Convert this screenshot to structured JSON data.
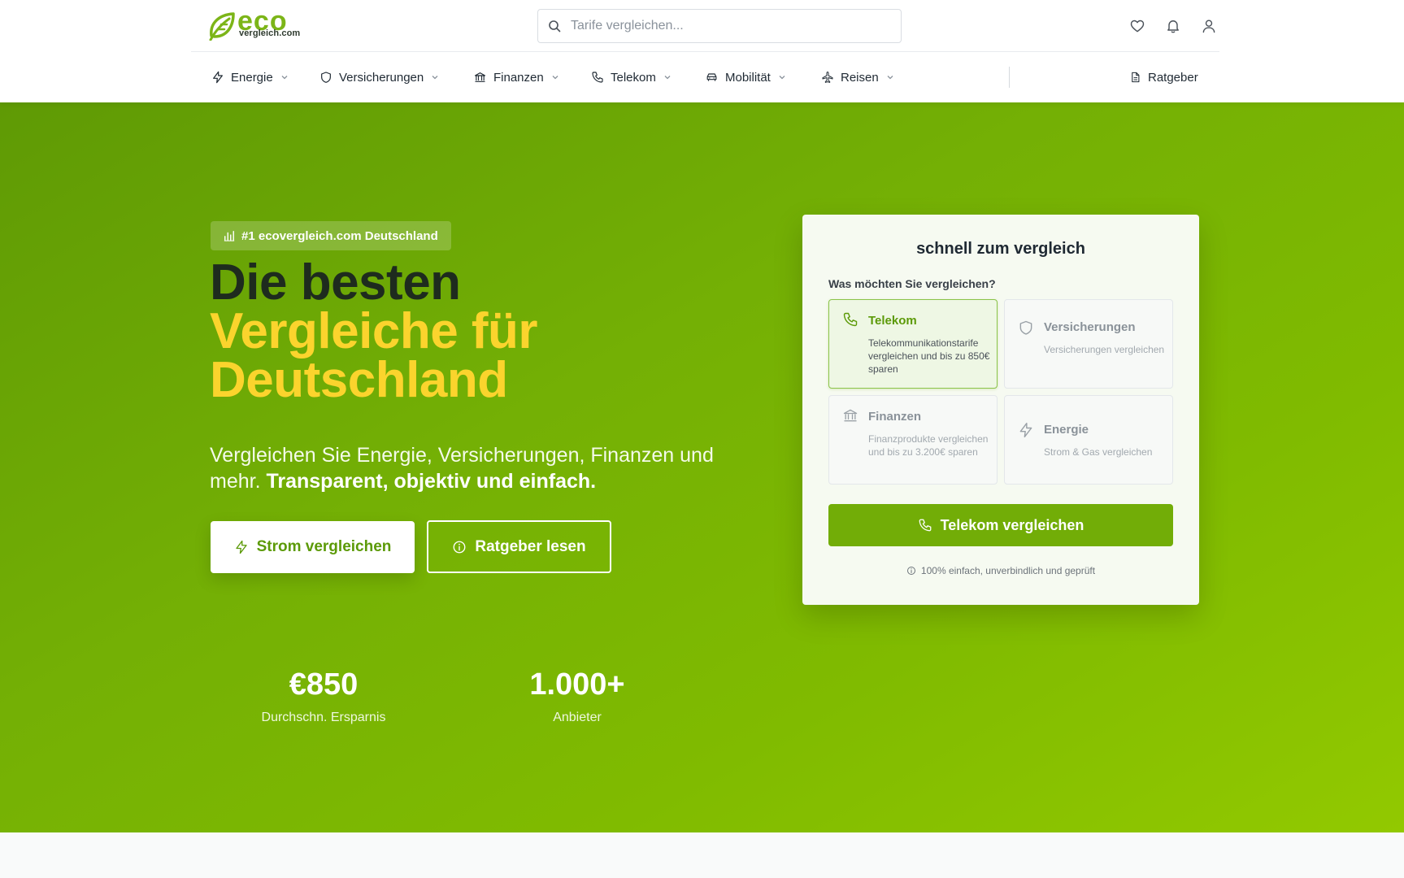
{
  "header": {
    "logo": {
      "brand": "eco",
      "domain": "vergleich.com"
    },
    "search": {
      "placeholder": "Tarife vergleichen..."
    },
    "icons": [
      "heart-icon",
      "bell-icon",
      "user-icon"
    ]
  },
  "nav": {
    "items": [
      {
        "label": "Energie",
        "icon": "bolt-icon"
      },
      {
        "label": "Versicherungen",
        "icon": "shield-icon"
      },
      {
        "label": "Finanzen",
        "icon": "bank-icon"
      },
      {
        "label": "Telekom",
        "icon": "phone-icon"
      },
      {
        "label": "Mobilität",
        "icon": "car-icon"
      },
      {
        "label": "Reisen",
        "icon": "plane-icon"
      }
    ],
    "guide": {
      "label": "Ratgeber",
      "icon": "document-icon"
    }
  },
  "hero": {
    "badge": "#1 ecovergleich.com Deutschland",
    "headline_line1": "Die besten",
    "headline_line2": "Vergleiche für",
    "headline_line3": "Deutschland",
    "subline": "Vergleichen Sie Energie, Versicherungen, Finanzen und mehr.",
    "subline_bold": "Transparent, objektiv und einfach.",
    "primary_button": "Strom vergleichen",
    "secondary_button": "Ratgeber lesen",
    "stats": [
      {
        "value": "€850",
        "label": "Durchschn. Ersparnis"
      },
      {
        "value": "1.000+",
        "label": "Anbieter"
      }
    ]
  },
  "quick_compare": {
    "title": "schnell zum vergleich",
    "question": "Was möchten Sie vergleichen?",
    "options": [
      {
        "title": "Telekom",
        "description": "Telekommunikationstarife vergleichen und bis zu 850€ sparen",
        "icon": "phone-icon",
        "selected": true
      },
      {
        "title": "Versicherungen",
        "description": "Versicherungen vergleichen",
        "icon": "shield-icon",
        "selected": false
      },
      {
        "title": "Finanzen",
        "description": "Finanzprodukte vergleichen und bis zu 3.200€ sparen",
        "icon": "bank-icon",
        "selected": false
      },
      {
        "title": "Energie",
        "description": "Strom & Gas vergleichen",
        "icon": "bolt-icon",
        "selected": false
      }
    ],
    "button": "Telekom vergleichen",
    "note": "100% einfach, unverbindlich und geprüft"
  },
  "colors": {
    "accent": "#7cb518",
    "headline_dark": "#1e2b1e",
    "headline_yellow": "#fbd42d",
    "button_green": "#72ad07"
  }
}
